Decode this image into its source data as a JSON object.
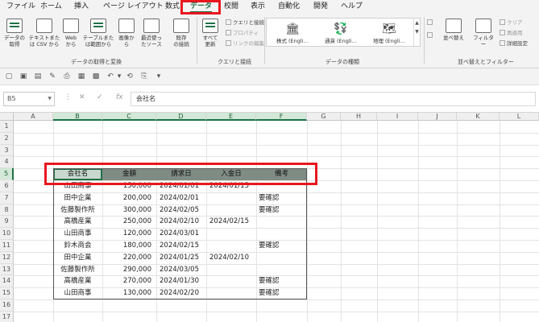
{
  "ribbon_tabs": [
    "ファイル",
    "ホーム",
    "挿入",
    "ページ レイアウト",
    "数式",
    "データ",
    "校閲",
    "表示",
    "自動化",
    "開発",
    "ヘルプ"
  ],
  "active_tab": "データ",
  "ribbon": {
    "get_data_label": "データの\n取得",
    "from_text_label": "テキストまた\nは CSV から",
    "from_web_label": "Web\nから",
    "from_table_label": "テーブルまた\nは範囲から",
    "from_image_label": "画像か\nら",
    "recent_sources_label": "最近使っ\nたソース",
    "existing_connections_label": "既存\nの接続",
    "group_get_transform": "データの取得と変換",
    "refresh_all_label": "すべて\n更新",
    "queries_connections_label": "クエリと接続",
    "properties_label": "プロパティ",
    "edit_links_label": "リンクの編集",
    "group_queries": "クエリと接続",
    "stocks_label": "株式 (Engli…",
    "currency_label": "通貨 (Engli…",
    "geography_label": "地理 (Engli…",
    "group_data_types": "データの種類",
    "sort_label": "並べ替え",
    "filter_label": "フィルター",
    "clear_label": "クリア",
    "reapply_label": "再適用",
    "advanced_label": "詳細設定",
    "group_sort_filter": "並べ替えとフィルター"
  },
  "formula_bar": {
    "name_box": "B5",
    "cancel": "✕",
    "enter": "✓",
    "fx": "fx",
    "value": "会社名"
  },
  "columns": [
    "A",
    "B",
    "C",
    "D",
    "E",
    "F",
    "G",
    "H",
    "I",
    "J",
    "K",
    "L"
  ],
  "rows": [
    "1",
    "2",
    "3",
    "4",
    "5",
    "6",
    "7",
    "8",
    "9",
    "10",
    "11",
    "12",
    "13",
    "14",
    "15",
    "16",
    "17"
  ],
  "table": {
    "headers": [
      "会社名",
      "金額",
      "請求日",
      "入金日",
      "備考"
    ],
    "rows": [
      [
        "山田商事",
        "150,000",
        "2024/01/01",
        "2024/01/15",
        ""
      ],
      [
        "田中企業",
        "200,000",
        "2024/02/01",
        "",
        "要確認"
      ],
      [
        "佐藤製作所",
        "300,000",
        "2024/02/05",
        "",
        "要確認"
      ],
      [
        "高橋産業",
        "250,000",
        "2024/02/10",
        "2024/02/15",
        ""
      ],
      [
        "山田商事",
        "120,000",
        "2024/03/01",
        "",
        ""
      ],
      [
        "鈴木商会",
        "180,000",
        "2024/02/15",
        "",
        "要確認"
      ],
      [
        "田中企業",
        "220,000",
        "2024/01/25",
        "2024/02/10",
        ""
      ],
      [
        "佐藤製作所",
        "290,000",
        "2024/03/05",
        "",
        ""
      ],
      [
        "高橋産業",
        "270,000",
        "2024/01/30",
        "",
        "要確認"
      ],
      [
        "山田商事",
        "130,000",
        "2024/02/20",
        "",
        "要確認"
      ]
    ]
  },
  "colors": {
    "accent": "#1e7145",
    "highlight": "#e8171f",
    "header_fill": "#7f8c84"
  }
}
